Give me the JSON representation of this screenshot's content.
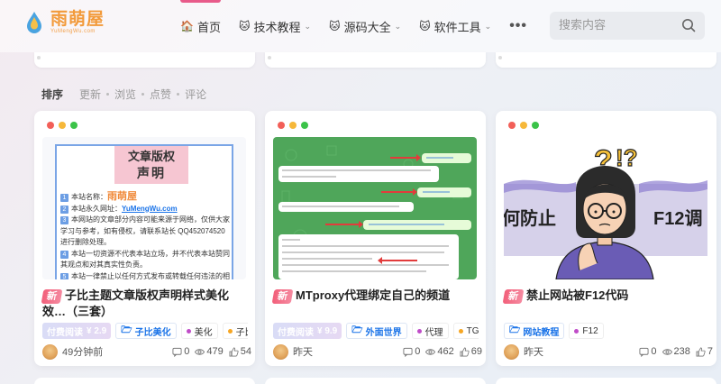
{
  "site": {
    "logo_title": "雨萌屋",
    "logo_sub": "YuMengWu.com"
  },
  "nav": {
    "items": [
      {
        "emoji": "🏠",
        "label": "首页",
        "has_dropdown": false,
        "active": true
      },
      {
        "emoji": "🐱",
        "label": "技术教程",
        "has_dropdown": true,
        "active": false
      },
      {
        "emoji": "🐱",
        "label": "源码大全",
        "has_dropdown": true,
        "active": false
      },
      {
        "emoji": "🐱",
        "label": "软件工具",
        "has_dropdown": true,
        "active": false
      }
    ],
    "more": "•••"
  },
  "search": {
    "placeholder": "搜索内容",
    "icon": "search-icon"
  },
  "sort": {
    "label": "排序",
    "options": [
      "更新",
      "浏览",
      "点赞",
      "评论"
    ]
  },
  "cards": [
    {
      "new_tag": "新",
      "title": "子比主题文章版权声明样式美化效…（三套）",
      "price_label": "付费阅读",
      "price_value": "¥ 2.9",
      "category": "子比美化",
      "tags": [
        {
          "label": "美化",
          "color": "#c04cc8"
        },
        {
          "label": "子比",
          "color": "#f6a623"
        }
      ],
      "author": "49分钟前",
      "comments": "0",
      "views": "479",
      "likes": "54",
      "doc": {
        "head_1": "文章版权",
        "head_2": "声明",
        "lines": [
          {
            "n": "1",
            "text": "本站名称：",
            "highlight": "雨萌屋"
          },
          {
            "n": "2",
            "text": "本站永久网址：",
            "link": "YuMengWu.com"
          },
          {
            "n": "3",
            "text": "本网站的文章部分内容可能来源于网络，仅供大家学习与参考，如有侵权，请联系站长 QQ452074520进行删除处理。"
          },
          {
            "n": "4",
            "text": "本站一切资源不代表本站立场，并不代表本站赞同其观点和对其真实性负责。"
          },
          {
            "n": "5",
            "text": "本站一律禁止以任何方式发布或转载任何违法的相关"
          }
        ]
      }
    },
    {
      "new_tag": "新",
      "title": "MTproxy代理绑定自己的频道",
      "price_label": "付费阅读",
      "price_value": "¥ 9.9",
      "category": "外面世界",
      "tags": [
        {
          "label": "代理",
          "color": "#c04cc8"
        },
        {
          "label": "TG",
          "color": "#f6a623"
        }
      ],
      "author": "昨天",
      "comments": "0",
      "views": "462",
      "likes": "69"
    },
    {
      "new_tag": "新",
      "title": "禁止网站被F12代码",
      "price_label": "",
      "price_value": "",
      "category": "网站教程",
      "tags": [
        {
          "label": "F12",
          "color": "#c04cc8"
        }
      ],
      "author": "昨天",
      "comments": "0",
      "views": "238",
      "likes": "7",
      "banner_left": "何防止",
      "banner_right": "F12调"
    }
  ],
  "colors": {
    "accent": "#e85a8a",
    "category_blue": "#1a73e8",
    "logo_orange": "#f29a3a"
  }
}
